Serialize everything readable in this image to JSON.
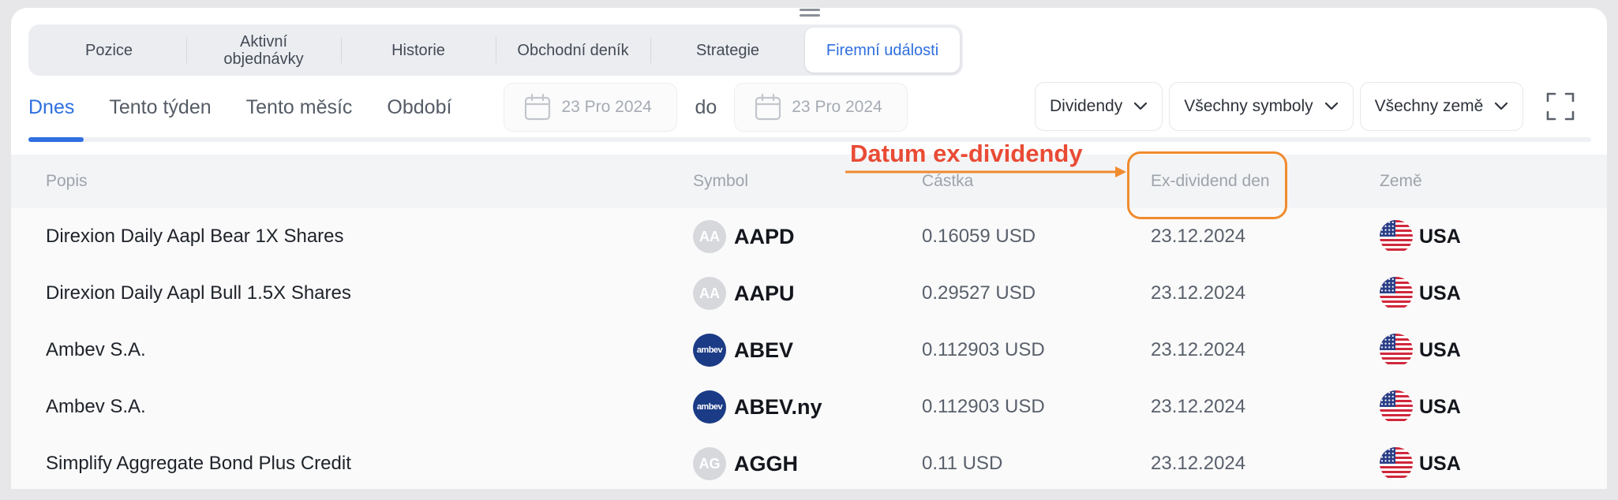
{
  "tabs": [
    {
      "label": "Pozice",
      "active": false
    },
    {
      "label": "Aktivní\nobjednávky",
      "active": false
    },
    {
      "label": "Historie",
      "active": false
    },
    {
      "label": "Obchodní deník",
      "active": false
    },
    {
      "label": "Strategie",
      "active": false
    },
    {
      "label": "Firemní události",
      "active": true
    }
  ],
  "periods": [
    "Dnes",
    "Tento týden",
    "Tento měsíc",
    "Období"
  ],
  "active_period": "Dnes",
  "date_from": "23 Pro 2024",
  "date_to_label": "do",
  "date_to": "23 Pro 2024",
  "filters": {
    "type": "Dividendy",
    "symbols": "Všechny symboly",
    "countries": "Všechny země"
  },
  "table": {
    "headers": {
      "description": "Popis",
      "symbol": "Symbol",
      "amount": "Částka",
      "ex_date": "Ex-dividend den",
      "country": "Země"
    },
    "rows": [
      {
        "description": "Direxion Daily Aapl Bear 1X Shares",
        "logo": "AA",
        "logo_style": "grey",
        "symbol": "AAPD",
        "amount": "0.16059 USD",
        "ex_date": "23.12.2024",
        "country": "USA"
      },
      {
        "description": "Direxion Daily Aapl Bull 1.5X Shares",
        "logo": "AA",
        "logo_style": "grey",
        "symbol": "AAPU",
        "amount": "0.29527 USD",
        "ex_date": "23.12.2024",
        "country": "USA"
      },
      {
        "description": "Ambev S.A.",
        "logo": "ambev",
        "logo_style": "blue",
        "symbol": "ABEV",
        "amount": "0.112903 USD",
        "ex_date": "23.12.2024",
        "country": "USA"
      },
      {
        "description": "Ambev S.A.",
        "logo": "ambev",
        "logo_style": "blue",
        "symbol": "ABEV.ny",
        "amount": "0.112903 USD",
        "ex_date": "23.12.2024",
        "country": "USA"
      },
      {
        "description": "Simplify Aggregate Bond Plus Credit",
        "logo": "AG",
        "logo_style": "grey",
        "symbol": "AGGH",
        "amount": "0.11 USD",
        "ex_date": "23.12.2024",
        "country": "USA"
      }
    ]
  },
  "annotation": {
    "text": "Datum ex-dividendy",
    "color": "#e94b35",
    "highlight_color": "#f08b2e"
  },
  "colors": {
    "accent": "#2f6fe0"
  }
}
